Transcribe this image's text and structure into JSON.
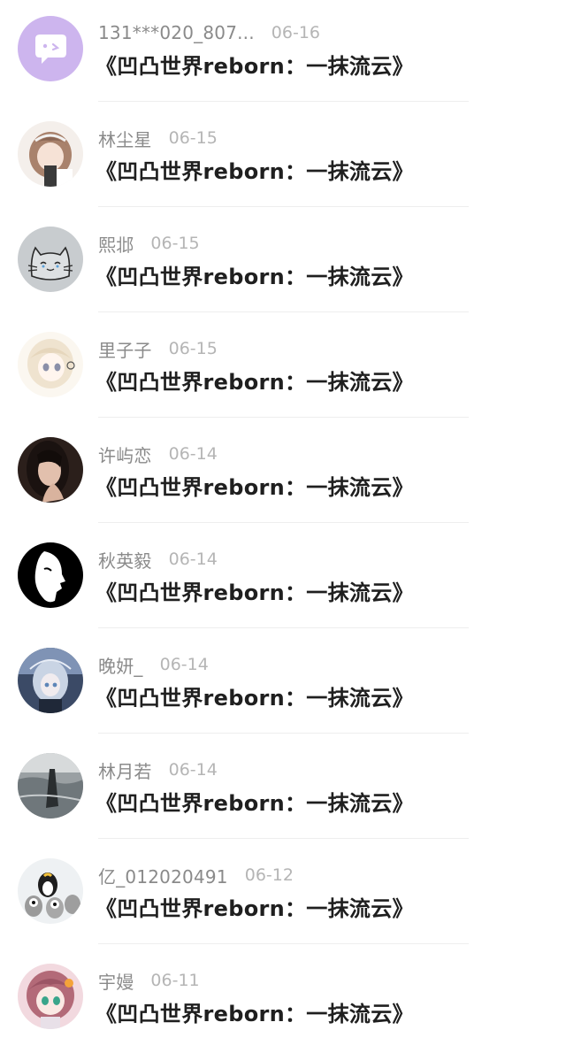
{
  "items": [
    {
      "username": "131***020_807...",
      "date": "06-16",
      "title": "《凹凸世界reborn：一抹流云》",
      "avatar": "chat-bubble-avatar"
    },
    {
      "username": "林尘星",
      "date": "06-15",
      "title": "《凹凸世界reborn：一抹流云》",
      "avatar": "anime-girl-avatar"
    },
    {
      "username": "熙邶",
      "date": "06-15",
      "title": "《凹凸世界reborn：一抹流云》",
      "avatar": "cat-sketch-avatar"
    },
    {
      "username": "里子子",
      "date": "06-15",
      "title": "《凹凸世界reborn：一抹流云》",
      "avatar": "anime-girl-avatar"
    },
    {
      "username": "许屿恋",
      "date": "06-14",
      "title": "《凹凸世界reborn：一抹流云》",
      "avatar": "photo-avatar"
    },
    {
      "username": "秋英毅",
      "date": "06-14",
      "title": "《凹凸世界reborn：一抹流云》",
      "avatar": "mask-face-avatar"
    },
    {
      "username": "晚妍_",
      "date": "06-14",
      "title": "《凹凸世界reborn：一抹流云》",
      "avatar": "anime-girl-avatar"
    },
    {
      "username": "林月若",
      "date": "06-14",
      "title": "《凹凸世界reborn：一抹流云》",
      "avatar": "photo-avatar"
    },
    {
      "username": "亿_012020491",
      "date": "06-12",
      "title": "《凹凸世界reborn：一抹流云》",
      "avatar": "penguin-avatar"
    },
    {
      "username": "宇嫚",
      "date": "06-11",
      "title": "《凹凸世界reborn：一抹流云》",
      "avatar": "anime-girl-avatar"
    }
  ]
}
